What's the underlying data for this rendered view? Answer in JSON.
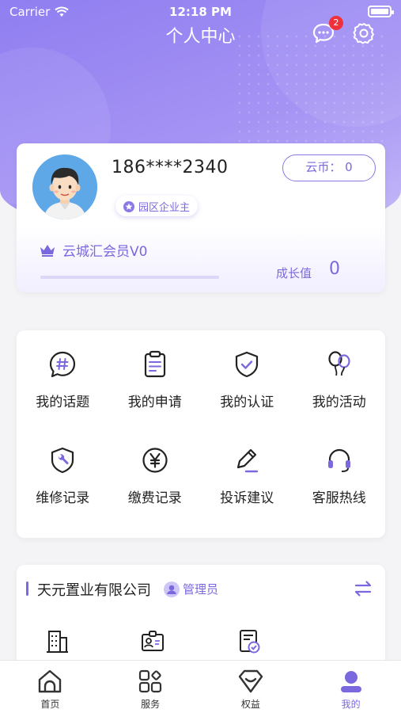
{
  "status_bar": {
    "carrier": "Carrier",
    "time": "12:18 PM"
  },
  "header": {
    "title": "个人中心",
    "message_badge": "2"
  },
  "profile": {
    "phone": "186****2340",
    "coin_label": "云币：  0",
    "role_tag": "园区企业主",
    "member_level": "云城汇会员V0",
    "growth_label": "成长值",
    "growth_value": "0",
    "progress_fraction": 0.0
  },
  "menu": {
    "items": [
      {
        "label": "我的话题",
        "icon": "topic-icon"
      },
      {
        "label": "我的申请",
        "icon": "clipboard-icon"
      },
      {
        "label": "我的认证",
        "icon": "shield-check-icon"
      },
      {
        "label": "我的活动",
        "icon": "balloons-icon"
      },
      {
        "label": "维修记录",
        "icon": "wrench-shield-icon"
      },
      {
        "label": "缴费记录",
        "icon": "yen-circle-icon"
      },
      {
        "label": "投诉建议",
        "icon": "pen-icon"
      },
      {
        "label": "客服热线",
        "icon": "headset-icon"
      }
    ]
  },
  "company": {
    "name": "天元置业有限公司",
    "role": "管理员"
  },
  "tabbar": {
    "items": [
      {
        "label": "首页",
        "icon": "home-icon"
      },
      {
        "label": "服务",
        "icon": "grid-services-icon"
      },
      {
        "label": "权益",
        "icon": "benefits-icon"
      },
      {
        "label": "我的",
        "icon": "profile-icon"
      }
    ]
  },
  "colors": {
    "accent": "#7a69de",
    "badge": "#f0303a"
  }
}
